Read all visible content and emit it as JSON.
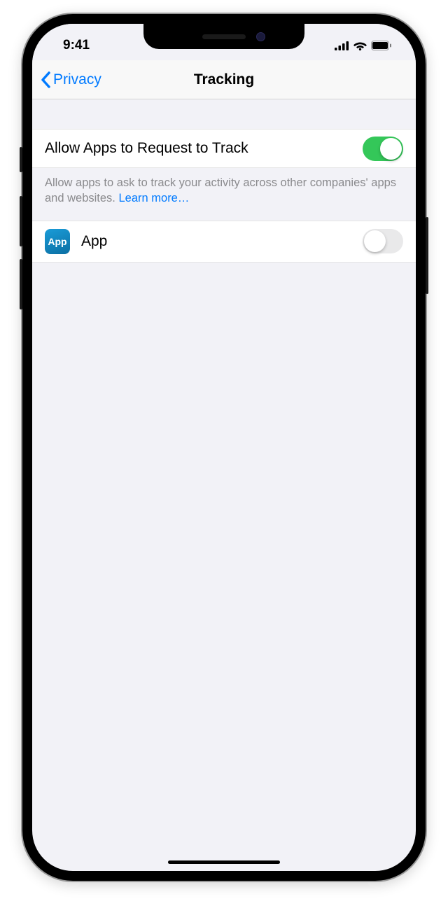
{
  "status": {
    "time": "9:41"
  },
  "nav": {
    "back_label": "Privacy",
    "title": "Tracking"
  },
  "settings": {
    "allow_track_label": "Allow Apps to Request to Track",
    "allow_track_on": true,
    "footer_text": "Allow apps to ask to track your activity across other companies' apps and websites. ",
    "learn_more": "Learn more…"
  },
  "apps": [
    {
      "icon_label": "App",
      "name": "App",
      "tracking_on": false
    }
  ]
}
